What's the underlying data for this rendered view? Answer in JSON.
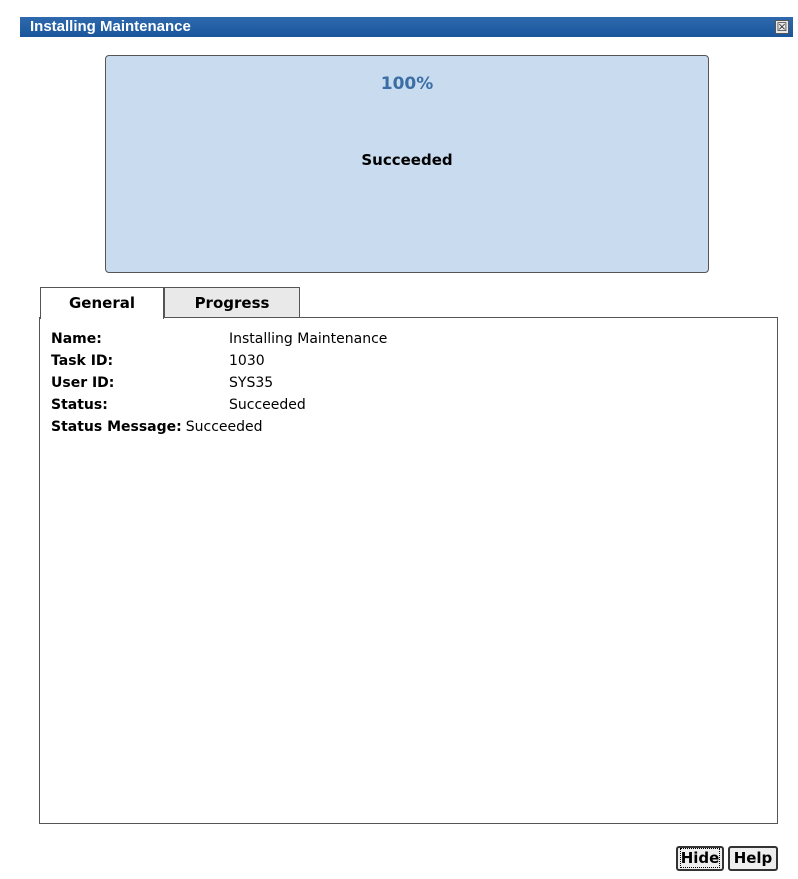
{
  "dialog": {
    "title": "Installing Maintenance",
    "close_glyph": "☒"
  },
  "progress": {
    "percent_text": "100%",
    "status_text": "Succeeded"
  },
  "tabs": [
    {
      "label": "General",
      "active": true
    },
    {
      "label": "Progress",
      "active": false
    }
  ],
  "general": {
    "rows": [
      {
        "label": "Name:",
        "value": "Installing Maintenance"
      },
      {
        "label": "Task ID:",
        "value": "1030"
      },
      {
        "label": "User ID:",
        "value": "SYS35"
      },
      {
        "label": "Status:",
        "value": "Succeeded"
      },
      {
        "label": "Status Message:",
        "value": "Succeeded"
      }
    ]
  },
  "buttons": {
    "hide_label": "Hide",
    "help_label": "Help"
  },
  "colors": {
    "title_bar": "#19559b",
    "progress_bg": "#c9dcef",
    "percent_text": "#3a6ea5"
  }
}
